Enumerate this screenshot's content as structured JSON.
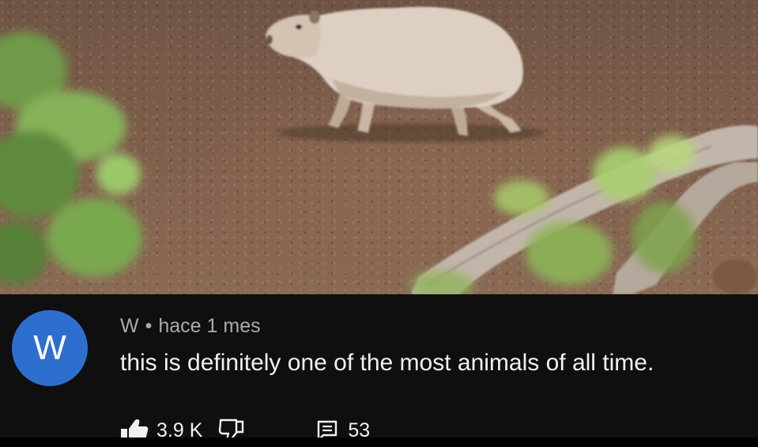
{
  "comment": {
    "avatar_letter": "W",
    "author": "W",
    "separator": "•",
    "time": "hace 1 mes",
    "text": "this is definitely one of the most animals of all time.",
    "likes": "3.9 K",
    "replies": "53"
  },
  "colors": {
    "avatar_bg": "#2d6fce",
    "background": "#0f0f0f",
    "meta_text": "#aaaaaa",
    "comment_text": "#f1f1f1"
  },
  "icons": {
    "like": "thumbs-up-icon",
    "dislike": "thumbs-down-icon",
    "reply": "comment-icon"
  }
}
